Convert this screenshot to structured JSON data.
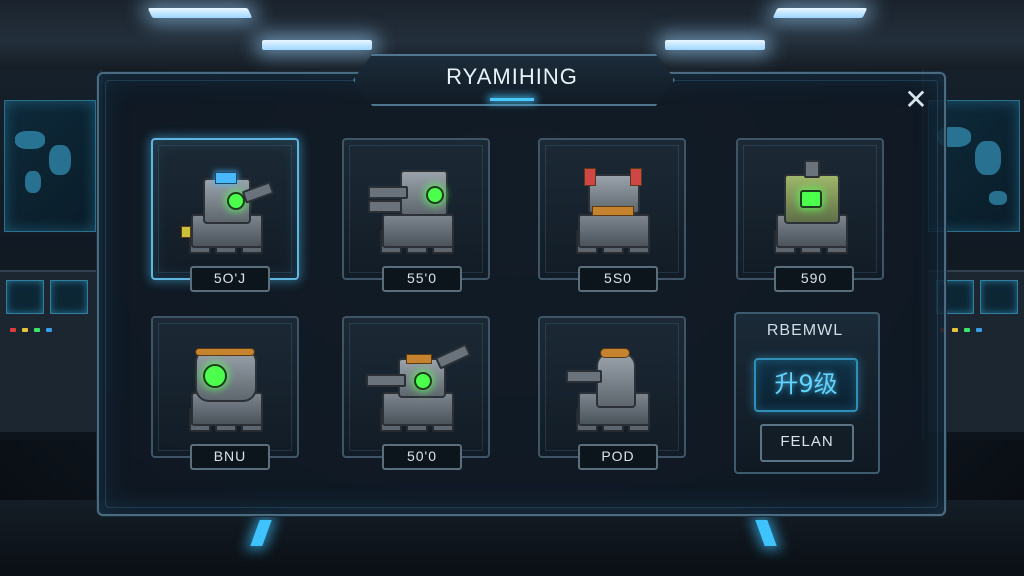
{
  "title": "RYAMIHING",
  "close_label": "✕",
  "towers": [
    {
      "price": "5O'J",
      "selected": true
    },
    {
      "price": "55'0",
      "selected": false
    },
    {
      "price": "5S0",
      "selected": false
    },
    {
      "price": "590",
      "selected": false
    },
    {
      "price": "BNU",
      "selected": false
    },
    {
      "price": "50'0",
      "selected": false
    },
    {
      "price": "POD",
      "selected": false
    }
  ],
  "info_panel": {
    "label": "RBEMWL",
    "upgrade_label": "升9级",
    "release_label": "FELAN"
  },
  "colors": {
    "accent": "#49c8ff",
    "gem": "#4dff4d",
    "panel_border": "#4b6b80"
  }
}
